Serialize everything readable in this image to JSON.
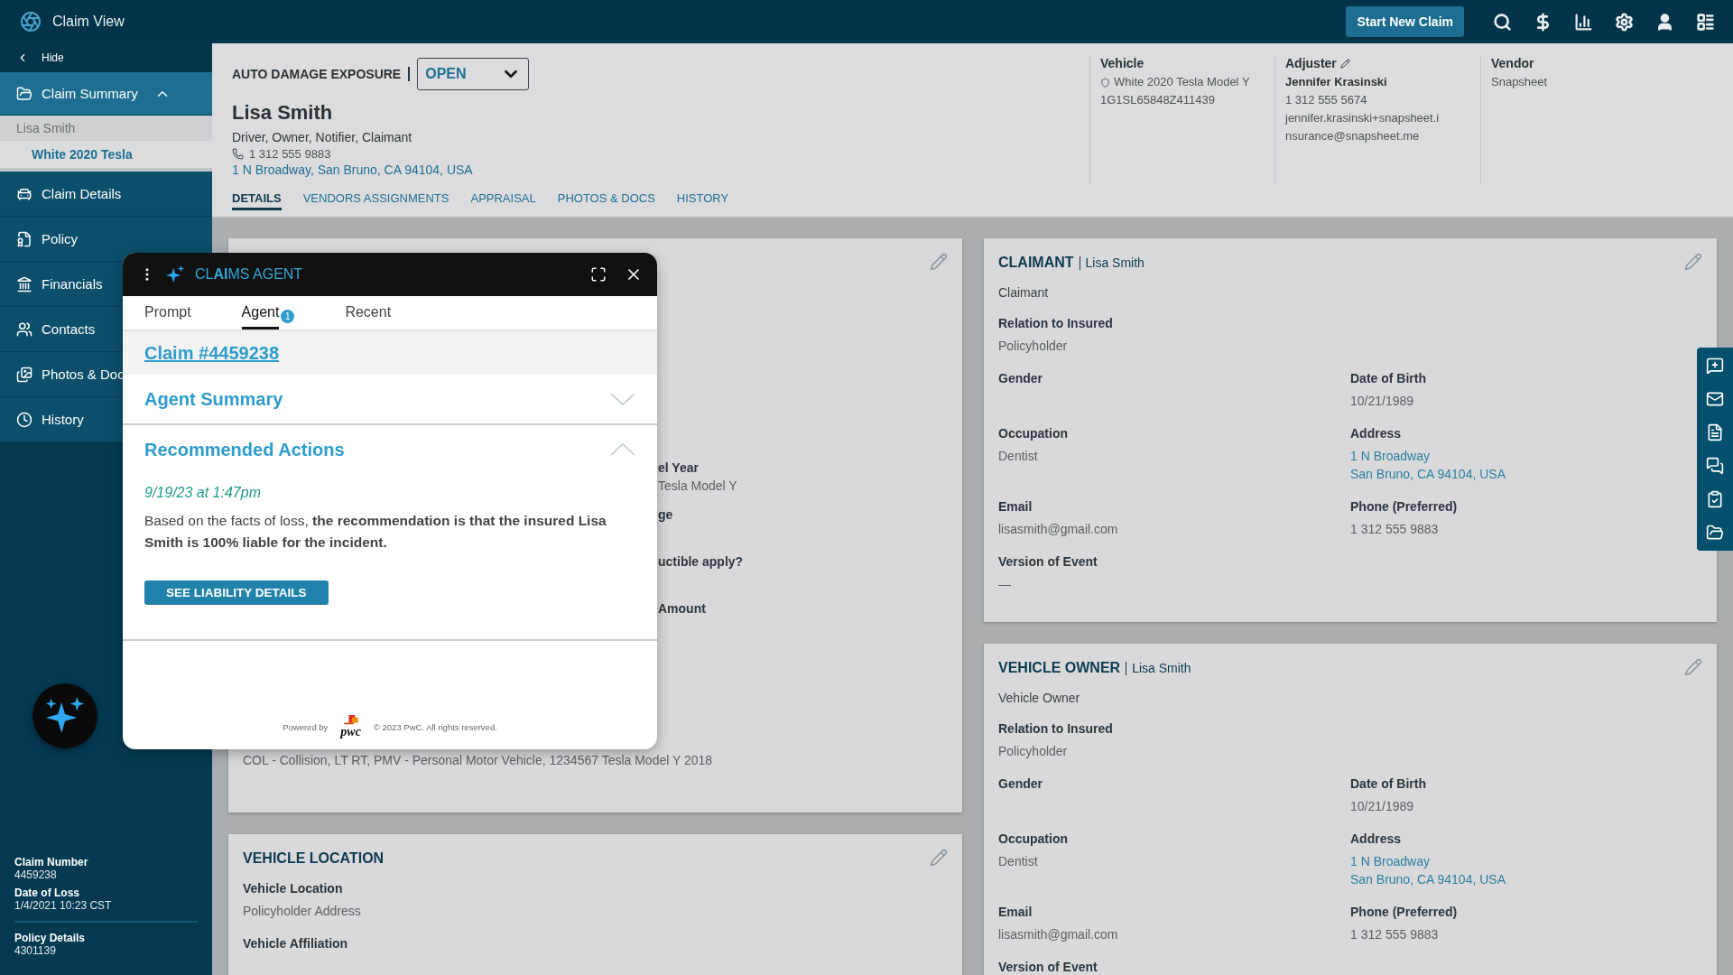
{
  "top_bar": {
    "title": "Claim View",
    "new_claim_button": "Start New Claim"
  },
  "sidebar": {
    "hide": "Hide",
    "items": [
      {
        "label": "Claim Summary",
        "selected": true,
        "expanded": true,
        "children": [
          {
            "label": "Lisa Smith",
            "selected": false,
            "children": [
              {
                "label": "White 2020 Tesla",
                "selected": true
              }
            ]
          }
        ]
      },
      {
        "label": "Claim Details",
        "selected": false
      },
      {
        "label": "Policy",
        "selected": false
      },
      {
        "label": "Financials",
        "selected": false
      },
      {
        "label": "Contacts",
        "selected": false
      },
      {
        "label": "Photos & Doc",
        "selected": false
      },
      {
        "label": "History",
        "selected": false
      }
    ],
    "details": [
      {
        "label": "Claim Number",
        "value": "4459238"
      },
      {
        "label": "Date of Loss",
        "value": "1/4/2021 10:23 CST"
      },
      {
        "label": "Policy Details",
        "value": "4301139"
      }
    ]
  },
  "header": {
    "exposure_label": "AUTO DAMAGE EXPOSURE",
    "status": "OPEN",
    "name": "Lisa Smith",
    "roles": "Driver, Owner, Notifier, Claimant",
    "phone": "1 312 555 9883",
    "address": "1 N Broadway, San Bruno, CA 94104, USA",
    "tabs": [
      {
        "label": "DETAILS",
        "selected": true
      },
      {
        "label": "VENDORS ASSIGNMENTS",
        "selected": false
      },
      {
        "label": "APPRAISAL",
        "selected": false
      },
      {
        "label": "PHOTOS & DOCS",
        "selected": false
      },
      {
        "label": "HISTORY",
        "selected": false
      }
    ],
    "info": [
      {
        "title": "Vehicle",
        "editable": false,
        "lines": [
          {
            "text": "White 2020 Tesla Model Y",
            "kind": "shield"
          },
          {
            "text": "1G1SL65848Z411439",
            "kind": "plain"
          }
        ]
      },
      {
        "title": "Adjuster",
        "editable": true,
        "lines": [
          {
            "text": "Jennifer Krasinski",
            "kind": "bold"
          },
          {
            "text": "1 312 555 5674",
            "kind": "plain"
          },
          {
            "text": "jennifer.krasinski+snapsheet.i",
            "kind": "plain"
          },
          {
            "text": "nsurance@snapsheet.me",
            "kind": "plain"
          }
        ]
      },
      {
        "title": "Vendor",
        "editable": false,
        "lines": [
          {
            "text": "Snapsheet",
            "kind": "plain"
          }
        ]
      }
    ]
  },
  "details_card": {
    "fragments": [
      {
        "label": "el Year",
        "value": "Tesla Model Y"
      },
      {
        "label": "ge"
      },
      {
        "label": "uctible apply?"
      },
      {
        "label": "Amount"
      }
    ],
    "coverage": "COL - Collision, LT RT, PMV - Personal Motor Vehicle, 1234567 Tesla Model Y 2018"
  },
  "location_card": {
    "title": "VEHICLE LOCATION",
    "fields": [
      {
        "label": "Vehicle Location",
        "value": [
          "Policyholder Address"
        ]
      },
      {
        "label": "Vehicle Affiliation"
      }
    ]
  },
  "party_cards": [
    {
      "title": "CLAIMANT",
      "name": "Lisa Smith",
      "role": "Claimant",
      "rows": [
        [
          {
            "label": "Relation to Insured",
            "kind": "text",
            "value": [
              "Policyholder"
            ]
          }
        ],
        [
          {
            "label": "Gender"
          },
          {
            "label": "Date of Birth",
            "kind": "text",
            "value": [
              "10/21/1989"
            ]
          }
        ],
        [
          {
            "label": "Occupation",
            "kind": "text",
            "value": [
              "Dentist"
            ]
          },
          {
            "label": "Address",
            "kind": "link",
            "value": [
              "1 N Broadway",
              "San Bruno, CA 94104, USA"
            ]
          }
        ],
        [
          {
            "label": "Email",
            "kind": "text",
            "value": [
              "lisasmith@gmail.com"
            ]
          },
          {
            "label": "Phone (Preferred)",
            "kind": "text",
            "value": [
              "1 312 555 9883"
            ]
          }
        ],
        [
          {
            "label": "Version of Event",
            "kind": "text",
            "value": [
              "—"
            ]
          }
        ]
      ]
    },
    {
      "title": "VEHICLE OWNER",
      "name": "Lisa Smith",
      "role": "Vehicle Owner",
      "rows": [
        [
          {
            "label": "Relation to Insured",
            "kind": "text",
            "value": [
              "Policyholder"
            ]
          }
        ],
        [
          {
            "label": "Gender"
          },
          {
            "label": "Date of Birth",
            "kind": "text",
            "value": [
              "10/21/1989"
            ]
          }
        ],
        [
          {
            "label": "Occupation",
            "kind": "text",
            "value": [
              "Dentist"
            ]
          },
          {
            "label": "Address",
            "kind": "link",
            "value": [
              "1 N Broadway",
              "San Bruno, CA 94104, USA"
            ]
          }
        ],
        [
          {
            "label": "Email",
            "kind": "text",
            "value": [
              "lisasmith@gmail.com"
            ]
          },
          {
            "label": "Phone (Preferred)",
            "kind": "text",
            "value": [
              "1 312 555 9883"
            ]
          }
        ],
        [
          {
            "label": "Version of Event"
          }
        ]
      ]
    }
  ],
  "agent_panel": {
    "title": "CL**AI**MS AGENT",
    "tabs": [
      {
        "label": "Prompt",
        "selected": false
      },
      {
        "label": "Agent",
        "selected": true,
        "badge": "1"
      },
      {
        "label": "Recent",
        "selected": false
      }
    ],
    "claim_link": "Claim #4459238",
    "sections": [
      {
        "title": "Agent Summary",
        "expanded": false
      },
      {
        "title": "Recommended Actions",
        "expanded": true,
        "timestamp": "9/19/23 at 1:47pm",
        "text": "Based on the facts of loss, **the recommendation is that the insured Lisa Smith is 100% liable for the incident.**",
        "button": "SEE LIABILITY DETAILS"
      }
    ],
    "footer": {
      "powered_by": "Powered by",
      "logo": "pwc",
      "copyright": "© 2023 PwC. All rights reserved."
    }
  }
}
